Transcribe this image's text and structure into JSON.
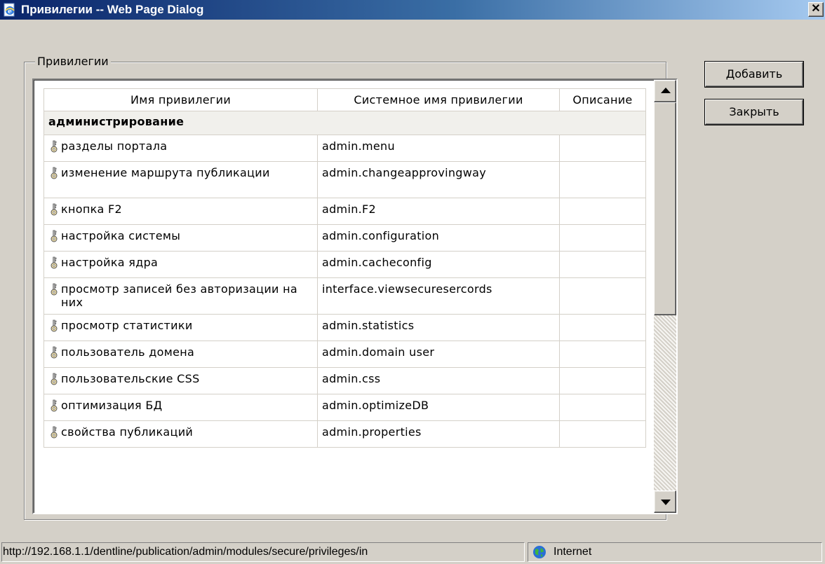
{
  "window": {
    "title": "Привилегии -- Web Page Dialog",
    "close_glyph": "✕"
  },
  "group": {
    "legend": "Привилегии"
  },
  "table": {
    "columns": [
      "Имя привилегии",
      "Системное имя привилегии",
      "Описание"
    ],
    "group_label": "администрирование",
    "rows": [
      {
        "name": "разделы портала",
        "system_name": "admin.menu",
        "description": ""
      },
      {
        "name": "изменение маршрута публикации",
        "system_name": "admin.changeapprovingway",
        "description": ""
      },
      {
        "name": "кнопка F2",
        "system_name": "admin.F2",
        "description": ""
      },
      {
        "name": "настройка системы",
        "system_name": "admin.configuration",
        "description": ""
      },
      {
        "name": "настройка ядра",
        "system_name": "admin.cacheconfig",
        "description": ""
      },
      {
        "name": "просмотр записей без авторизации на них",
        "system_name": "interface.viewsecuresercords",
        "description": ""
      },
      {
        "name": "просмотр статистики",
        "system_name": "admin.statistics",
        "description": ""
      },
      {
        "name": "пользователь домена",
        "system_name": "admin.domain user",
        "description": ""
      },
      {
        "name": "пользовательские CSS",
        "system_name": "admin.css",
        "description": ""
      },
      {
        "name": "оптимизация БД",
        "system_name": "admin.optimizeDB",
        "description": ""
      },
      {
        "name": "свойства публикаций",
        "system_name": "admin.properties",
        "description": ""
      }
    ],
    "row_icon": "key-icon"
  },
  "buttons": {
    "add": "Добавить",
    "close": "Закрыть"
  },
  "statusbar": {
    "url": "http://192.168.1.1/dentline/publication/admin/modules/secure/privileges/in",
    "zone_icon": "globe-icon",
    "zone": "Internet"
  },
  "scrollbar": {
    "position_fraction": 0.0
  }
}
